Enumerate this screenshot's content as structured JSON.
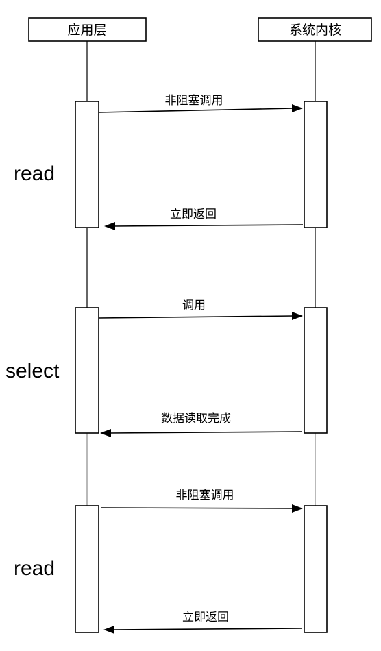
{
  "participants": {
    "app": "应用层",
    "kernel": "系统内核"
  },
  "phases": [
    {
      "label": "read",
      "request": "非阻塞调用",
      "response": "立即返回"
    },
    {
      "label": "select",
      "request": "调用",
      "response": "数据读取完成"
    },
    {
      "label": "read",
      "request": "非阻塞调用",
      "response": "立即返回"
    }
  ]
}
